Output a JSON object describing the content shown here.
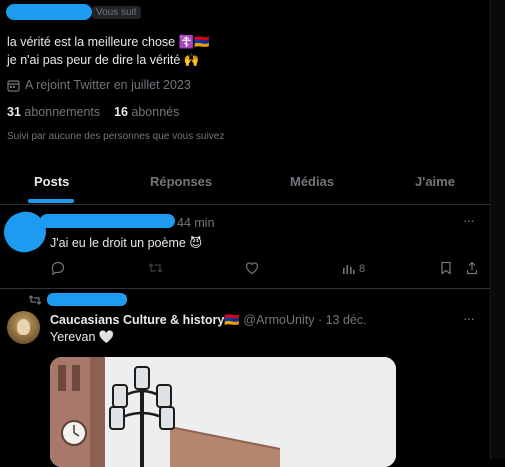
{
  "profile": {
    "follows_you_badge": "Vous suit",
    "bio_line1": "la vérité est la meilleure chose ☦️🇦🇲",
    "bio_line2": "je n'ai pas peur de dire la vérité 🙌",
    "joined": "A rejoint Twitter en juillet 2023",
    "following_count": "31",
    "following_label": "abonnements",
    "followers_count": "16",
    "followers_label": "abonnés",
    "followed_by_note": "Suivi par aucune des personnes que vous suivez"
  },
  "tabs": [
    {
      "label": "Posts",
      "active": true
    },
    {
      "label": "Réponses",
      "active": false
    },
    {
      "label": "Médias",
      "active": false
    },
    {
      "label": "J'aime",
      "active": false
    }
  ],
  "tweet1": {
    "time": "44 min",
    "text": "J'ai eu le droit un poème 😈",
    "views": "8"
  },
  "tweet2": {
    "author_name": "Caucasians Culture & history🇦🇲",
    "handle": "@ArmoUnity",
    "date": "· 13 déc.",
    "text": "Yerevan 🤍"
  },
  "colors": {
    "accent": "#1d9bf0",
    "background": "#000000",
    "muted": "#71767b",
    "divider": "#2f3336"
  }
}
